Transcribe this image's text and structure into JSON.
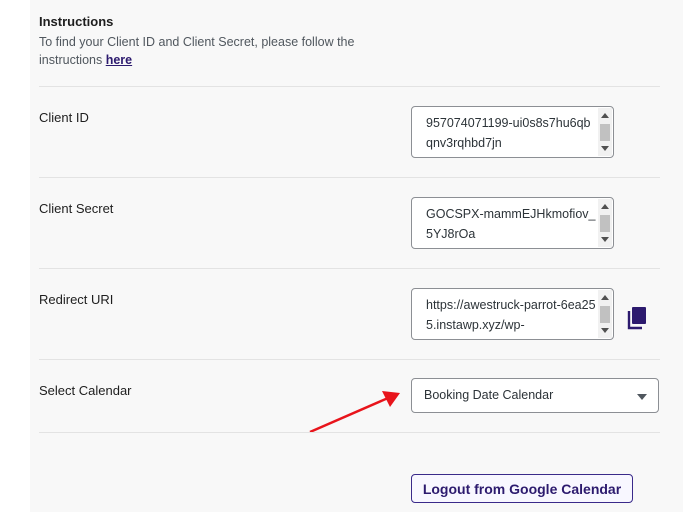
{
  "instructions": {
    "title": "Instructions",
    "text": "To find your Client ID and Client Secret, please follow the instructions",
    "link_text": "here"
  },
  "fields": {
    "client_id": {
      "label": "Client ID",
      "value": "957074071199-ui0s8s7hu6qbqnv3rqhbd7jn"
    },
    "client_secret": {
      "label": "Client Secret",
      "value": "GOCSPX-mammEJHkmofiov_5YJ8rOa"
    },
    "redirect_uri": {
      "label": "Redirect URI",
      "value": "https://awestruck-parrot-6ea255.instawp.xyz/wp-"
    },
    "calendar": {
      "label": "Select Calendar",
      "selected": "Booking Date Calendar"
    }
  },
  "actions": {
    "logout_label": "Logout from Google Calendar"
  },
  "icons": {
    "copy": "copy-icon"
  },
  "colors": {
    "accent": "#2c1a6e",
    "annotation_arrow": "#e8141b"
  }
}
